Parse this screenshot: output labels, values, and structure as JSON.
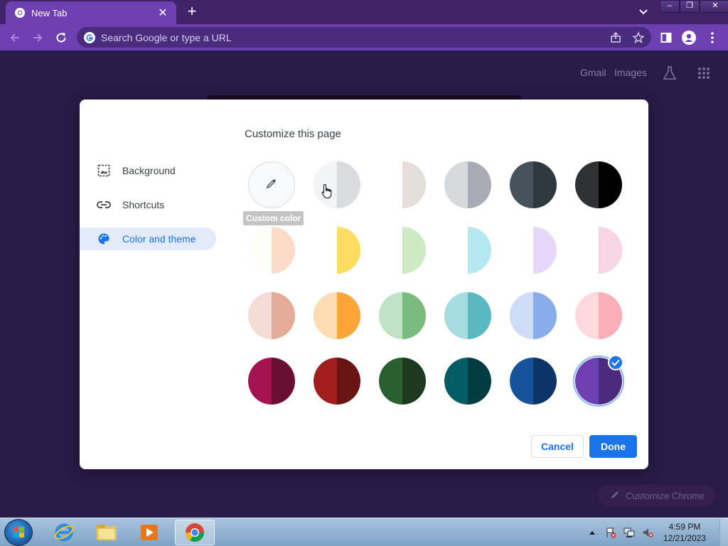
{
  "browser": {
    "tab_title": "New Tab",
    "omnibox_placeholder": "Search Google or type a URL"
  },
  "ntp": {
    "gmail": "Gmail",
    "images": "Images",
    "customize_chrome": "Customize Chrome"
  },
  "dialog": {
    "title": "Customize this page",
    "sidebar": [
      {
        "label": "Background",
        "icon": "image-icon"
      },
      {
        "label": "Shortcuts",
        "icon": "link-icon"
      },
      {
        "label": "Color and theme",
        "icon": "palette-icon",
        "active": true
      }
    ],
    "custom_color_tooltip": "Custom color",
    "themes": [
      [
        "#f1f3f4",
        "#dadce0"
      ],
      [
        "#ffffff",
        "#e6dedb"
      ],
      [
        "#d7d8dc",
        "#a8abb3"
      ],
      [
        "#46525c",
        "#2e383f"
      ],
      [
        "#303134",
        "#000000"
      ],
      [
        "#fffdf8",
        "#fcdcc8"
      ],
      [
        "#ffffff",
        "#fddc5f"
      ],
      [
        "#ffffff",
        "#cdeac3"
      ],
      [
        "#ffffff",
        "#b5e9f2"
      ],
      [
        "#ffffff",
        "#e7d7fb"
      ],
      [
        "#ffffff",
        "#f8d5e3"
      ],
      [
        "#f4ddd4",
        "#e4ab98"
      ],
      [
        "#fcdcb2",
        "#fda537"
      ],
      [
        "#c2e2c8",
        "#79bc7d"
      ],
      [
        "#a6dbe0",
        "#5ab8c1"
      ],
      [
        "#cfdcf7",
        "#88acec"
      ],
      [
        "#fdd8dc",
        "#fbaeb8"
      ],
      [
        "#a4134f",
        "#6a0f33"
      ],
      [
        "#a11d1e",
        "#6b1415"
      ],
      [
        "#2a5f2f",
        "#1d3a20"
      ],
      [
        "#015c64",
        "#003c41"
      ],
      [
        "#17539b",
        "#0d3466"
      ],
      [
        "#6d3fb0",
        "#4a2b7d"
      ]
    ],
    "selected_theme_index": 22,
    "cancel": "Cancel",
    "done": "Done"
  },
  "taskbar": {
    "time": "4:59 PM",
    "date": "12/21/2023"
  }
}
